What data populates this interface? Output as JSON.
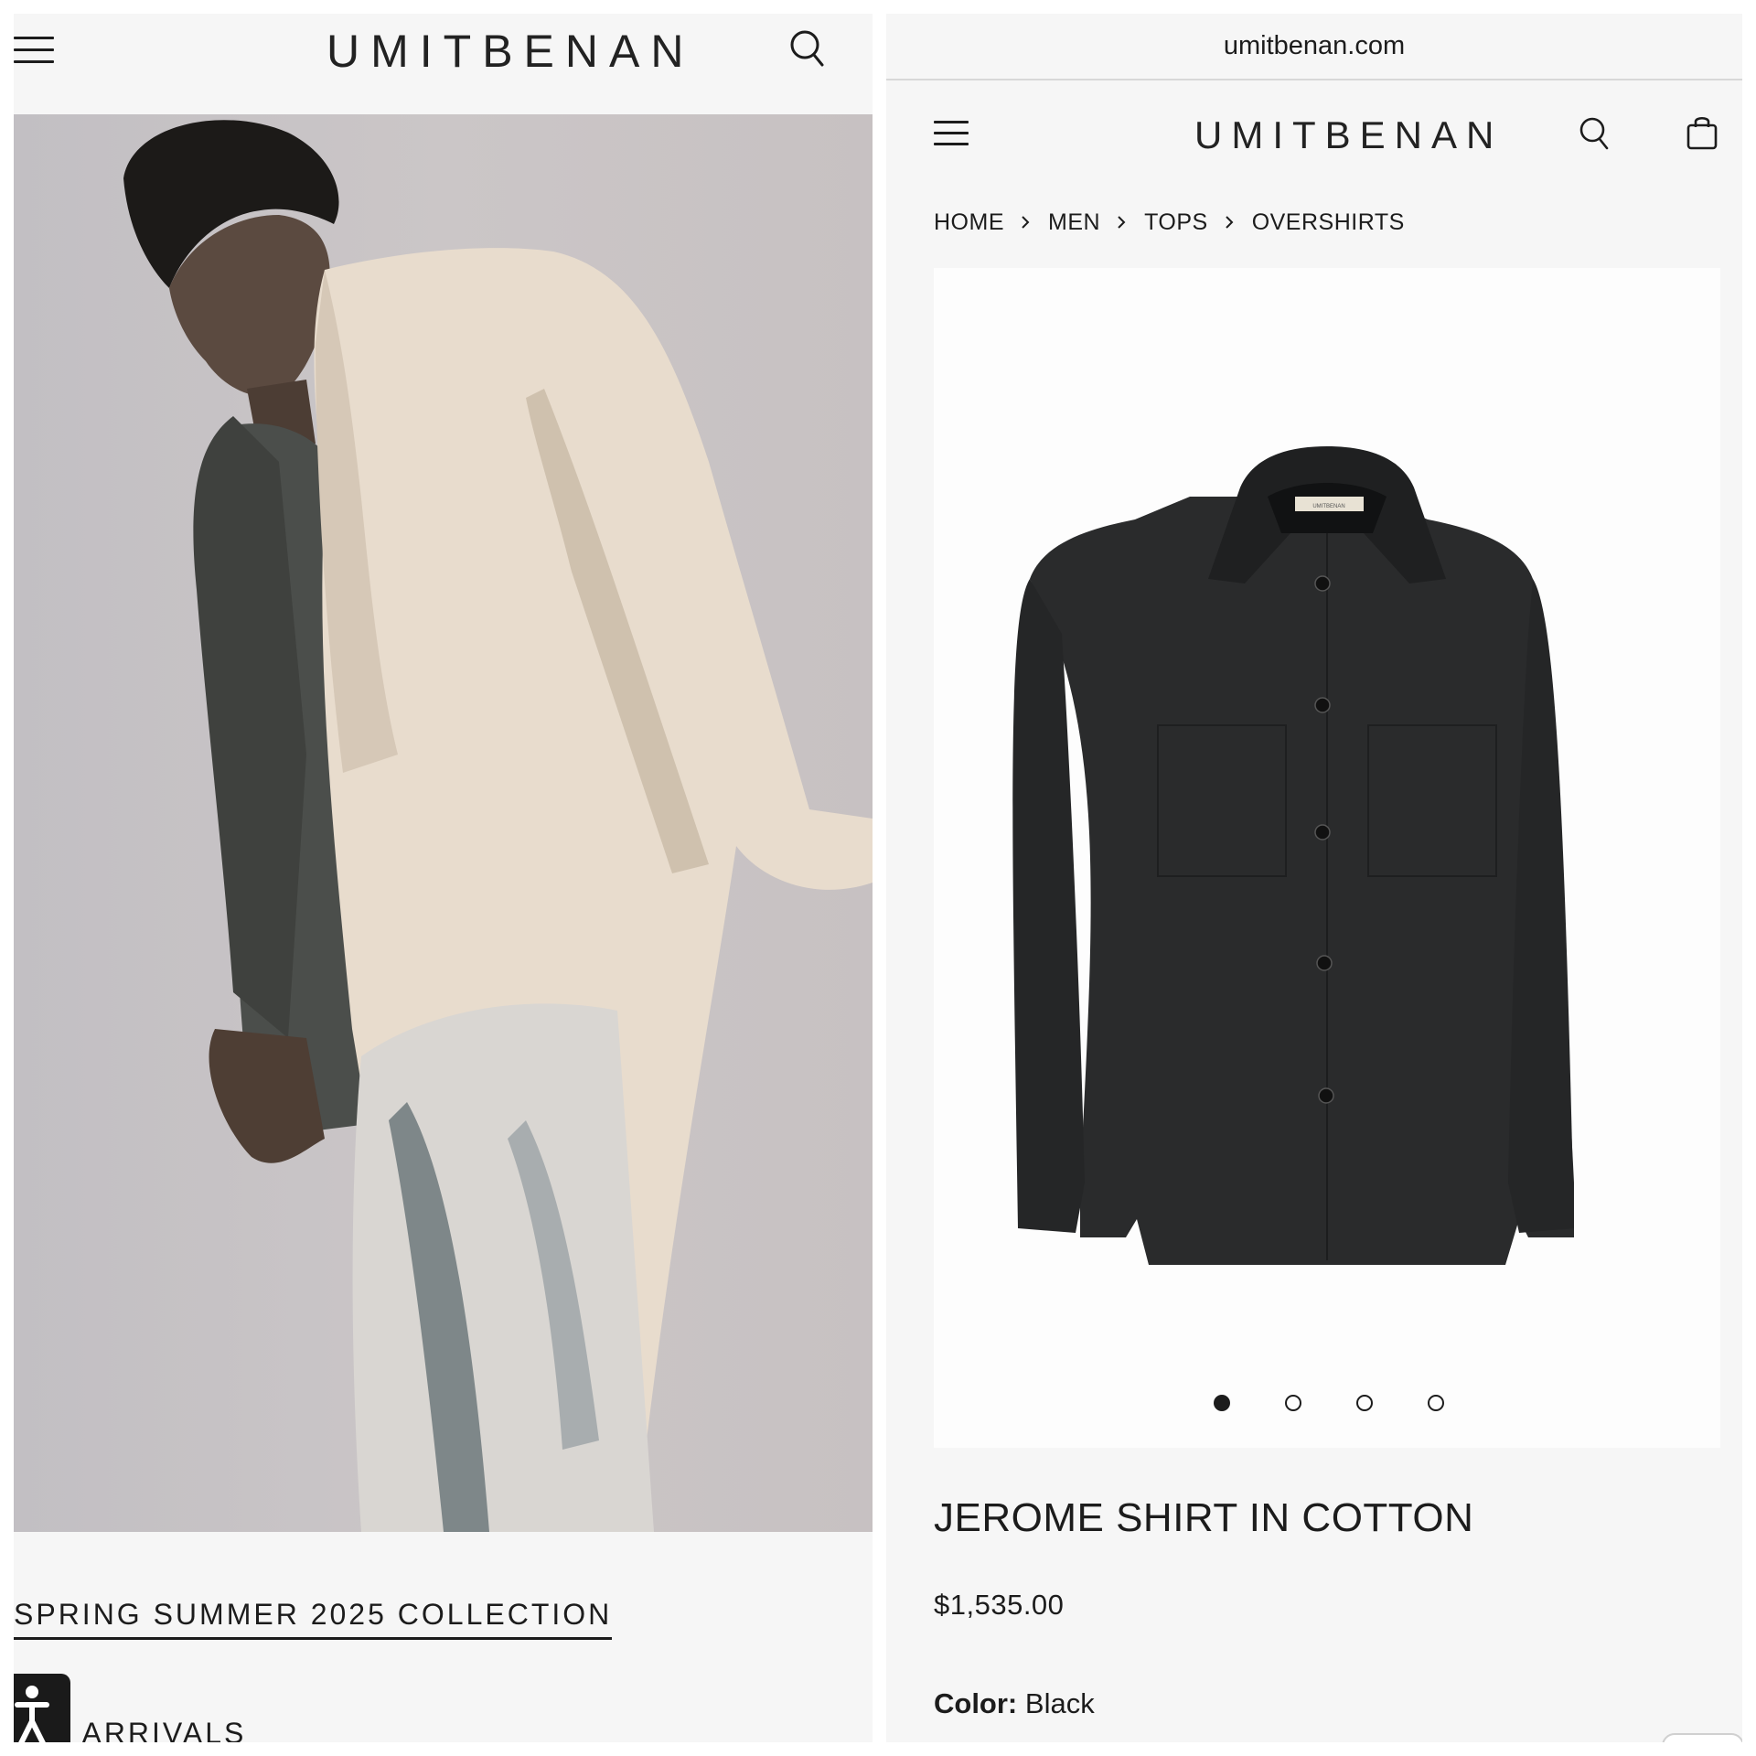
{
  "left_panel": {
    "brand": "UMITBENAN",
    "collection_link": "SPRING SUMMER 2025 COLLECTION",
    "new_arrivals_partial": "V ARRIVALS"
  },
  "right_panel": {
    "url": "umitbenan.com",
    "brand": "UMITBENAN",
    "breadcrumb": [
      "HOME",
      "MEN",
      "TOPS",
      "OVERSHIRTS"
    ],
    "product": {
      "label_tag": "UMITBENAN",
      "title": "JEROME SHIRT IN COTTON",
      "price": "$1,535.00",
      "color_label": "Color:",
      "color_value": "Black",
      "gallery_total": 4,
      "gallery_active_index": 0
    }
  },
  "icons": {
    "menu": "hamburger-menu-icon",
    "search": "search-icon",
    "bag": "shopping-bag-icon",
    "accessibility": "accessibility-icon",
    "breadcrumb_separator": "chevron-right-icon"
  },
  "colors": {
    "page_bg": "#f6f6f6",
    "text": "#1c1c1c",
    "product_bg": "#fdfdfd",
    "jacket": "#2a2b2c"
  }
}
